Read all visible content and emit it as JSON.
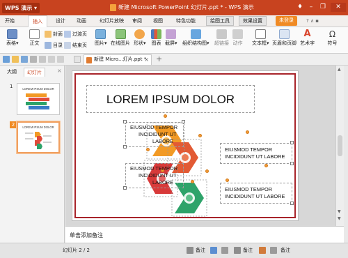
{
  "app": {
    "logo_label": "WPS 演示",
    "window_title": "新建 Microsoft PowerPoint 幻灯片.ppt * - WPS 演示"
  },
  "menu": {
    "items": [
      "开始",
      "插入",
      "设计",
      "动画",
      "幻灯片放映",
      "审阅",
      "视图",
      "特色功能"
    ],
    "draw_tools": "绘图工具",
    "effect_settings": "效果设置",
    "login": "未登录"
  },
  "toolbar": {
    "table": "表格",
    "text": "正文",
    "cover": "封面",
    "catalog": "目录",
    "transition": "过渡页",
    "ending": "结束页",
    "picture": "图片",
    "online_picture": "在线图片",
    "shape": "形状",
    "chart": "图表",
    "screenshot": "截屏",
    "smartart": "组织结构图",
    "hyperlink": "超链接",
    "action": "动作",
    "textbox": "文本框",
    "header_footer": "页眉和页脚",
    "wordart": "艺术字",
    "symbol": "符号"
  },
  "tabs": {
    "document_tab": "新建 Micro...灯片.ppt *",
    "add_tab": "+"
  },
  "left_panel": {
    "outline_tab": "大纲",
    "slides_tab": "幻灯片",
    "slide_numbers": [
      "1",
      "2"
    ],
    "thumb_title": "LOREM IPSUM DOLOR"
  },
  "slide": {
    "title": "LOREM IPSUM DOLOR",
    "text_boxes": [
      {
        "lines": [
          "EIUSMOD TEMPOR",
          "INCIDIDUNT UT",
          "LABORE"
        ]
      },
      {
        "lines": [
          "EIUSMOD TEMPOR",
          "INCIDIDUNT UT LABORE"
        ]
      },
      {
        "lines": [
          "EIUSMOD TEMPOR",
          "INCIDIDUNT UT",
          "LABORE"
        ]
      },
      {
        "lines": [
          "EIUSMOD TEMPOR",
          "INCIDIDUNT UT LABORE"
        ]
      }
    ],
    "colors": {
      "orange": "#f29a25",
      "red": "#e04a3a",
      "green": "#2ea36a",
      "frame": "#a8242a"
    }
  },
  "notes": {
    "placeholder": "单击添加备注"
  },
  "status": {
    "slide_counter": "幻灯片 2 / 2",
    "notes_label": "备注"
  }
}
